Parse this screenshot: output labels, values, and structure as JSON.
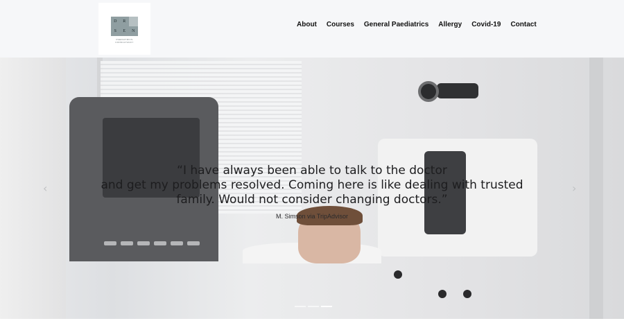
{
  "logo": {
    "cells": [
      "D",
      "R",
      "",
      "S",
      "E",
      "N"
    ],
    "tagline": "PAEDIATRICS CONSULTANCY"
  },
  "nav": {
    "items": [
      {
        "label": "About"
      },
      {
        "label": "Courses"
      },
      {
        "label": "General Paediatrics"
      },
      {
        "label": "Allergy"
      },
      {
        "label": "Covid-19"
      },
      {
        "label": "Contact"
      }
    ]
  },
  "slider": {
    "quote_line1": "“I have always been able to talk to the doctor",
    "quote_line2": "and get my problems resolved. Coming here is like dealing with trusted",
    "quote_line3": "family. Would not consider changing doctors.”",
    "attribution": "M. Simson via TripAdvisor",
    "prev_icon": "‹",
    "next_icon": "›",
    "slide_count": 3,
    "active_slide": 3
  }
}
